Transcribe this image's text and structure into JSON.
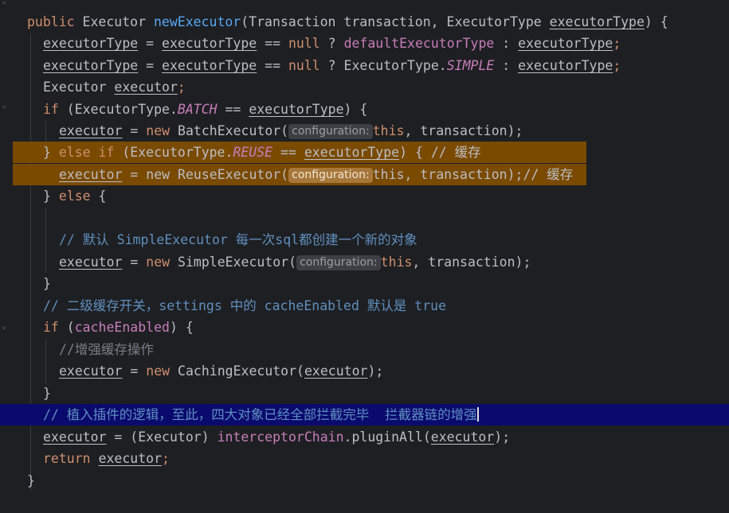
{
  "lines": {
    "l0": [
      "public",
      " ",
      "Executor",
      " ",
      "newExecutor",
      "(Transaction transaction, ExecutorType ",
      "executorType",
      ") {"
    ],
    "l1": [
      "executorType",
      " = ",
      "executorType",
      " == ",
      "null",
      " ? ",
      "defaultExecutorType",
      " : ",
      "executorType",
      ";"
    ],
    "l2": [
      "executorType",
      " = ",
      "executorType",
      " == ",
      "null",
      " ? ExecutorType.",
      "SIMPLE",
      " : ",
      "executorType",
      ";"
    ],
    "l3": [
      "Executor ",
      "executor",
      ";"
    ],
    "l4": [
      "if",
      " (ExecutorType.",
      "BATCH",
      " == ",
      "executorType",
      ") {"
    ],
    "l5": [
      "executor",
      " = ",
      "new",
      " BatchExecutor(",
      "configuration:",
      "this",
      ", transaction);"
    ],
    "l6": [
      "} ",
      "else if",
      " (ExecutorType.",
      "REUSE",
      " == ",
      "executorType",
      ") { ",
      "// 缓存"
    ],
    "l7": [
      "executor",
      " = ",
      "new",
      " ReuseExecutor(",
      "configuration:",
      "this",
      ", transaction);",
      "// 缓存"
    ],
    "l8": [
      "} ",
      "else",
      " {"
    ],
    "l10": [
      "// 默认 ",
      "SimpleExecutor",
      " 每一次sql都创建一个新的对象"
    ],
    "l11": [
      "executor",
      " = ",
      "new",
      " SimpleExecutor(",
      "configuration:",
      "this",
      ", transaction);"
    ],
    "l12": [
      "}"
    ],
    "l13": [
      "// 二级缓存开关，",
      "settings",
      " 中的 ",
      "cacheEnabled",
      " 默认是 ",
      "true"
    ],
    "l14": [
      "if",
      " (",
      "cacheEnabled",
      ") {"
    ],
    "l15": [
      "//增强缓存操作"
    ],
    "l16": [
      "executor",
      " = ",
      "new",
      " CachingExecutor(",
      "executor",
      ");"
    ],
    "l17": [
      "}"
    ],
    "l18": [
      "// 植入插件的逻辑，至此，四大对象已经全部拦截完毕  拦截器链的增强"
    ],
    "l19": [
      "executor",
      " = (Executor) ",
      "interceptorChain",
      ".pluginAll(",
      "executor",
      ");"
    ],
    "l20": [
      "return",
      " ",
      "executor",
      ";"
    ],
    "l21": [
      "}"
    ]
  },
  "colors": {
    "keyword": "#cf8e6d",
    "method": "#56a8f5",
    "field": "#c77dbb",
    "comment": "#7a7e85",
    "highlight_orange": "#7a4a00",
    "highlight_blue": "#0a0a6e"
  }
}
